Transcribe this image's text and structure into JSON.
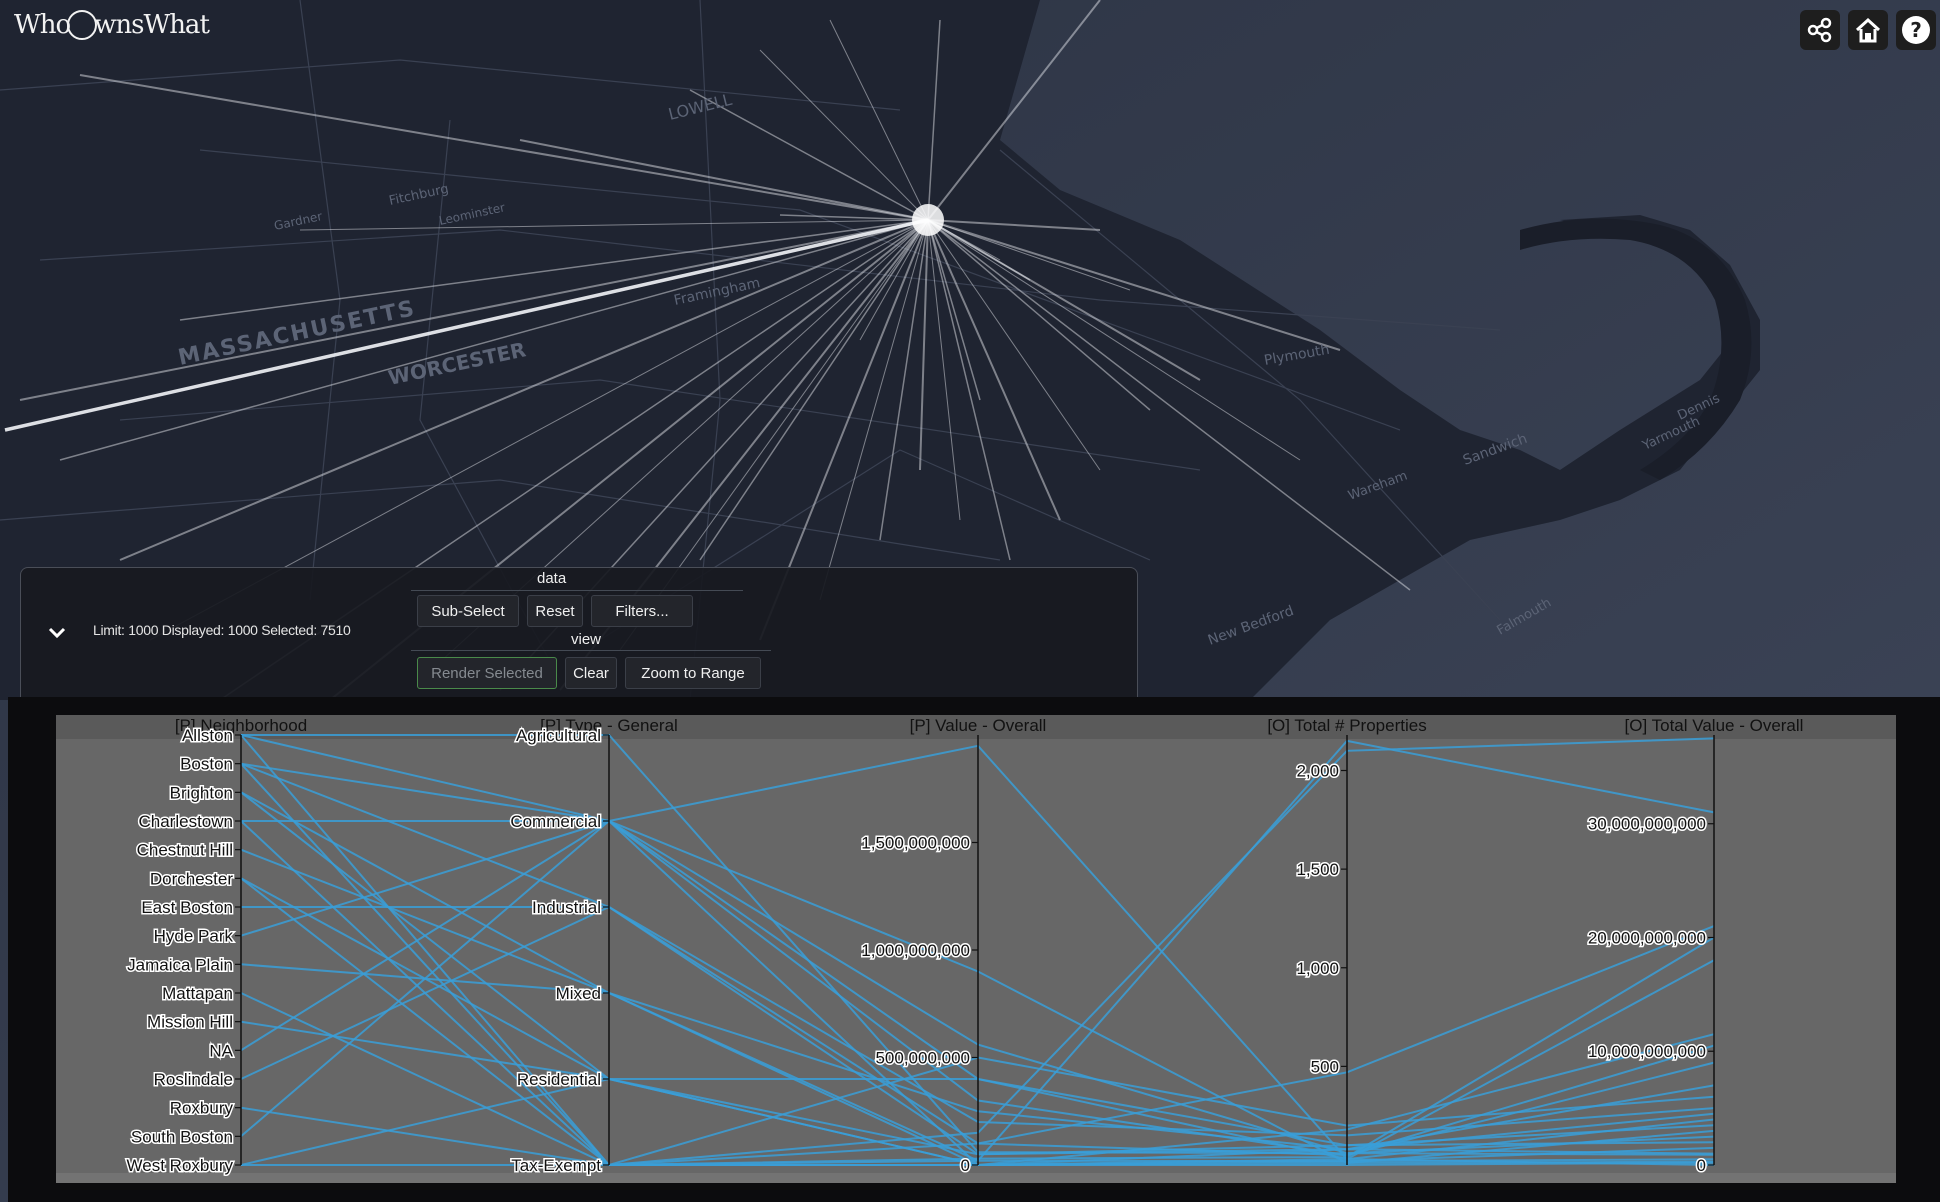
{
  "app": {
    "logo_text_left": "Who",
    "logo_text_right": "wnsWhat"
  },
  "toolbar": {
    "icons": [
      "share-icon",
      "home-icon",
      "help-icon"
    ]
  },
  "map": {
    "labels": [
      {
        "text": "MASSACHUSETTS",
        "id": "state"
      },
      {
        "text": "WORCESTER",
        "id": "worcester"
      },
      {
        "text": "LOWELL",
        "id": "lowell"
      },
      {
        "text": "Framingham",
        "id": "framingham"
      },
      {
        "text": "Fitchburg",
        "id": "fitchburg"
      },
      {
        "text": "Leominster",
        "id": "leominster"
      },
      {
        "text": "Gardner",
        "id": "gardner"
      },
      {
        "text": "Plymouth",
        "id": "plymouth"
      },
      {
        "text": "Sandwich",
        "id": "sandwich"
      },
      {
        "text": "Yarmouth",
        "id": "yarmouth"
      },
      {
        "text": "Dennis",
        "id": "dennis"
      },
      {
        "text": "Wareham",
        "id": "wareham"
      },
      {
        "text": "New Bedford",
        "id": "newbedford"
      },
      {
        "text": "Falmouth",
        "id": "falmouth"
      }
    ]
  },
  "panel": {
    "status": "Limit: 1000 Displayed: 1000 Selected: 7510",
    "data_label": "data",
    "view_label": "view",
    "buttons": {
      "sub_select": "Sub-Select",
      "reset": "Reset",
      "filters": "Filters...",
      "render_selected": "Render Selected",
      "clear": "Clear",
      "zoom_to_range": "Zoom to Range"
    }
  },
  "chart_data": {
    "type": "parallel-coordinates",
    "series_color": "#3a9fd8",
    "dimensions": [
      {
        "name": "[P] Neighborhood",
        "kind": "categorical",
        "categories": [
          "Allston",
          "Boston",
          "Brighton",
          "Charlestown",
          "Chestnut Hill",
          "Dorchester",
          "East Boston",
          "Hyde Park",
          "Jamaica Plain",
          "Mattapan",
          "Mission Hill",
          "NA",
          "Roslindale",
          "Roxbury",
          "South Boston",
          "West Roxbury"
        ]
      },
      {
        "name": "[P] Type - General",
        "kind": "categorical",
        "categories": [
          "Agricultural",
          "Commercial",
          "Industrial",
          "Mixed",
          "Residential",
          "Tax-Exempt"
        ]
      },
      {
        "name": "[P] Value - Overall",
        "kind": "numeric",
        "range": [
          0,
          2000000000
        ],
        "ticks": [
          0,
          500000000,
          1000000000,
          1500000000
        ],
        "tick_labels": [
          "0",
          "500,000,000",
          "1,000,000,000",
          "1,500,000,000"
        ]
      },
      {
        "name": "[O] Total # Properties",
        "kind": "numeric",
        "range": [
          0,
          2180
        ],
        "ticks": [
          500,
          1000,
          1500,
          2000
        ],
        "tick_labels": [
          "500",
          "1,000",
          "1,500",
          "2,000"
        ]
      },
      {
        "name": "[O] Total Value - Overall",
        "kind": "numeric",
        "range": [
          0,
          37800000000
        ],
        "ticks": [
          0,
          10000000000,
          20000000000,
          30000000000
        ],
        "tick_labels": [
          "0",
          "10,000,000,000",
          "20,000,000,000",
          "30,000,000,000"
        ]
      }
    ],
    "lines": [
      [
        "Allston",
        "Agricultural",
        60000000,
        60,
        900000000
      ],
      [
        "Allston",
        "Commercial",
        1950000000,
        30,
        4000000000
      ],
      [
        "Allston",
        "Tax-Exempt",
        150000000,
        2100,
        37500000000
      ],
      [
        "Boston",
        "Commercial",
        560000000,
        60,
        2500000000
      ],
      [
        "Boston",
        "Industrial",
        100000000,
        470,
        21000000000
      ],
      [
        "Boston",
        "Tax-Exempt",
        0,
        180,
        11500000000
      ],
      [
        "Brighton",
        "Residential",
        400000000,
        30,
        18000000000
      ],
      [
        "Brighton",
        "Mixed",
        20000000,
        2150,
        31000000000
      ],
      [
        "Charlestown",
        "Commercial",
        900000000,
        10,
        3000000000
      ],
      [
        "Charlestown",
        "Tax-Exempt",
        30000000,
        40,
        20000000000
      ],
      [
        "Chestnut Hill",
        "Mixed",
        250000000,
        80,
        7000000000
      ],
      [
        "Dorchester",
        "Residential",
        0,
        20,
        500000000
      ],
      [
        "Dorchester",
        "Tax-Exempt",
        0,
        10,
        300000000
      ],
      [
        "East Boston",
        "Industrial",
        50000000,
        100,
        3500000000
      ],
      [
        "Hyde Park",
        "Commercial",
        300000000,
        50,
        10500000000
      ],
      [
        "Jamaica Plain",
        "Mixed",
        0,
        0,
        200000000
      ],
      [
        "Mattapan",
        "Tax-Exempt",
        500000000,
        200,
        6000000000
      ],
      [
        "Mission Hill",
        "Residential",
        50000000,
        80,
        1000000000
      ],
      [
        "NA",
        "Commercial",
        0,
        30,
        0
      ],
      [
        "Roslindale",
        "Industrial",
        200000000,
        150,
        5000000000
      ],
      [
        "Roxbury",
        "Tax-Exempt",
        100000000,
        50,
        9000000000
      ],
      [
        "South Boston",
        "Commercial",
        400000000,
        100,
        2000000000
      ],
      [
        "West Roxbury",
        "Residential",
        0,
        80,
        4500000000
      ],
      [
        "West Roxbury",
        "Tax-Exempt",
        20000000,
        20,
        1500000000
      ]
    ]
  }
}
